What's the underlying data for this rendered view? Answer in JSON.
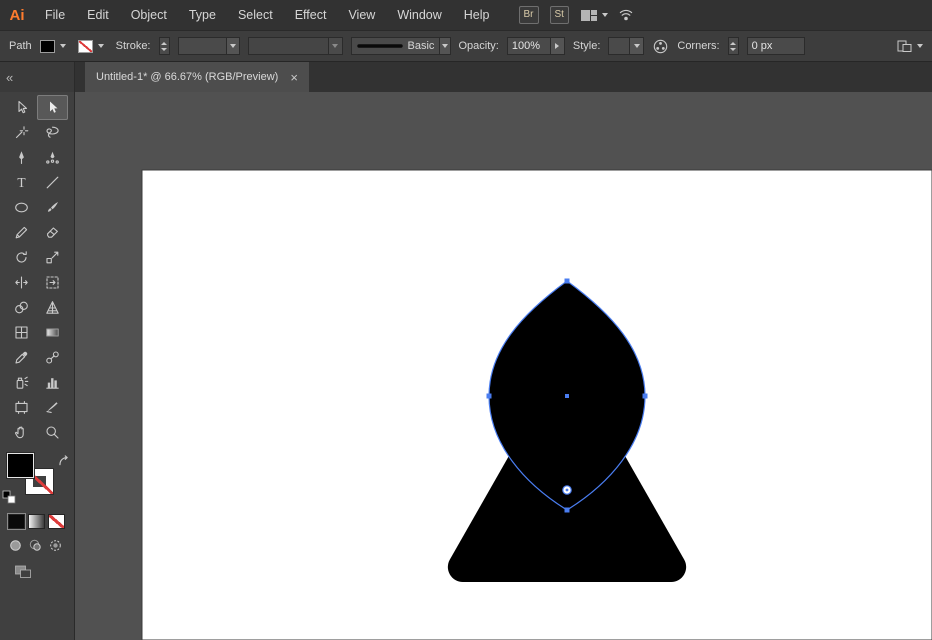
{
  "menubar": {
    "logo_text": "Ai",
    "items": [
      "File",
      "Edit",
      "Object",
      "Type",
      "Select",
      "Effect",
      "View",
      "Window",
      "Help"
    ],
    "bridge_label": "Br",
    "stock_label": "St",
    "icons": [
      "workspace-switcher-icon",
      "chevron-down-icon",
      "share-screen-icon"
    ]
  },
  "controlbar": {
    "selection_type_label": "Path",
    "fill_swatch": "#000000",
    "stroke_swatch": "none",
    "stroke_label": "Stroke:",
    "stroke_weight_value": "",
    "brush_name": "Basic",
    "opacity_label": "Opacity:",
    "opacity_value": "100%",
    "style_label": "Style:",
    "corners_label": "Corners:",
    "corners_value": "0 px",
    "icons": [
      "recolor-artwork-icon",
      "arrange-documents-icon"
    ]
  },
  "dock": {
    "collapse_glyph": "«",
    "type_glyph": "T",
    "selected_tool": "selection-tool",
    "tool_icons": [
      "direct-selection-tool-icon",
      "selection-tool-icon",
      "magic-wand-tool-icon",
      "lasso-tool-icon",
      "pen-tool-icon",
      "curvature-tool-icon",
      "type-tool-icon",
      "line-segment-tool-icon",
      "ellipse-tool-icon",
      "paintbrush-tool-icon",
      "pencil-tool-icon",
      "eraser-tool-icon",
      "rotate-tool-icon",
      "scale-tool-icon",
      "width-tool-icon",
      "free-transform-tool-icon",
      "shape-builder-tool-icon",
      "perspective-grid-tool-icon",
      "mesh-tool-icon",
      "gradient-tool-icon",
      "eyedropper-tool-icon",
      "blend-tool-icon",
      "symbol-sprayer-tool-icon",
      "column-graph-tool-icon",
      "artboard-tool-icon",
      "slice-tool-icon",
      "hand-tool-icon",
      "zoom-tool-icon"
    ],
    "swatch_icons": [
      "swap-fill-stroke-icon",
      "default-fill-stroke-icon",
      "fill-swatch",
      "stroke-swatch",
      "color-mode-icon",
      "gradient-mode-icon",
      "none-mode-icon",
      "draw-normal-icon",
      "draw-behind-icon",
      "draw-inside-icon",
      "screen-mode-icon"
    ]
  },
  "tabbar": {
    "title": "Untitled-1* @ 66.67% (RGB/Preview)",
    "close_glyph": "×"
  },
  "colors": {
    "accent_blue": "#4a7df0",
    "shape_black": "#000000",
    "artboard_white": "#ffffff",
    "logo_orange": "#ff7c2e",
    "stroke_none_red": "#dd3b3b"
  }
}
